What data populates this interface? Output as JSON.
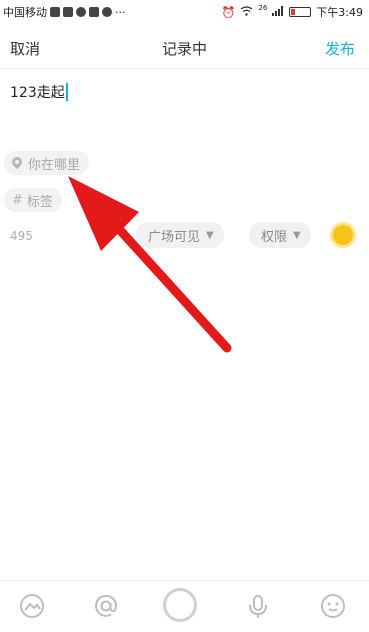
{
  "status_bar": {
    "carrier": "中国移动",
    "network": "4G",
    "time": "下午3:49",
    "signal_label": "26",
    "icons": [
      "alarm-icon",
      "wifi-icon",
      "signal-icon",
      "battery-icon"
    ]
  },
  "nav": {
    "cancel": "取消",
    "title": "记录中",
    "publish": "发布",
    "publish_color": "#1bb0d8"
  },
  "editor": {
    "text": "123走起"
  },
  "location_chip": {
    "label": "你在哪里",
    "icon": "location-pin-icon"
  },
  "tag_chip": {
    "prefix": "#",
    "label": "标签"
  },
  "char_count": "495",
  "visibility": {
    "label": "广场可见"
  },
  "permission": {
    "label": "权限"
  },
  "weather_icon": "sun-icon",
  "toolbar": {
    "items": [
      "image-icon",
      "mention-icon",
      "record-button",
      "mic-icon",
      "emoji-icon"
    ]
  },
  "annotation": {
    "color": "#e41a1a"
  }
}
